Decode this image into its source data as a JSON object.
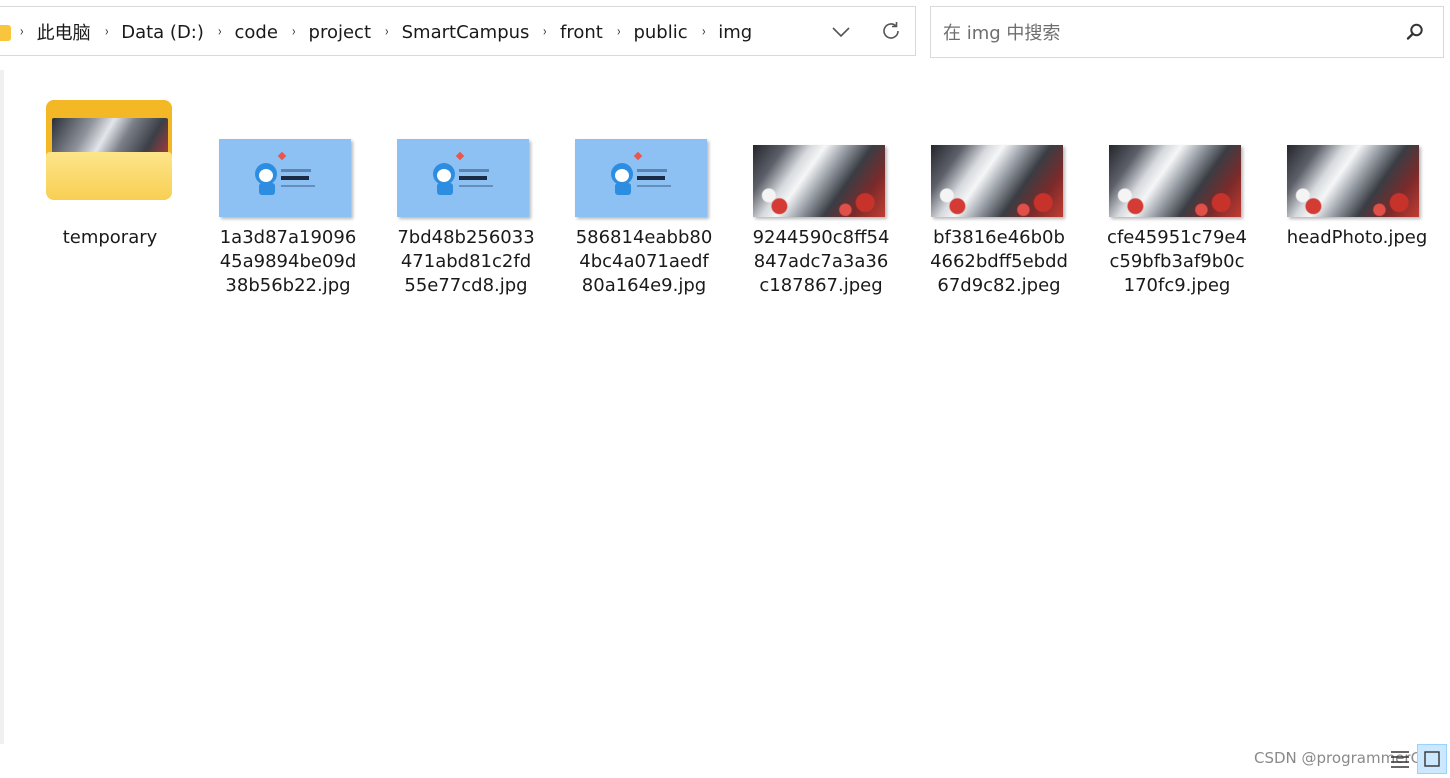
{
  "breadcrumb": {
    "items": [
      "此电脑",
      "Data (D:)",
      "code",
      "project",
      "SmartCampus",
      "front",
      "public",
      "img"
    ],
    "separator": "›"
  },
  "search": {
    "placeholder": "在 img 中搜索",
    "icon": "search-icon"
  },
  "files": [
    {
      "name": "temporary",
      "type": "folder",
      "thumb": "mecha"
    },
    {
      "name": "1a3d87a1909645a9894be09d38b56b22.jpg",
      "type": "image",
      "thumb": "doraemon"
    },
    {
      "name": "7bd48b256033471abd81c2fd55e77cd8.jpg",
      "type": "image",
      "thumb": "doraemon"
    },
    {
      "name": "586814eabb804bc4a071aedf80a164e9.jpg",
      "type": "image",
      "thumb": "doraemon"
    },
    {
      "name": "9244590c8ff54847adc7a3a36c187867.jpeg",
      "type": "image",
      "thumb": "mecha"
    },
    {
      "name": "bf3816e46b0b4662bdff5ebdd67d9c82.jpeg",
      "type": "image",
      "thumb": "mecha"
    },
    {
      "name": "cfe45951c79e4c59bfb3af9b0c170fc9.jpeg",
      "type": "image",
      "thumb": "mecha"
    },
    {
      "name": "headPhoto.jpeg",
      "type": "image",
      "thumb": "mecha"
    }
  ],
  "watermark": "CSDN @programmerCV",
  "colors": {
    "folder": "#f4b826",
    "doraemon_bg": "#8ec1f3",
    "selected_view": "#cce8ff"
  }
}
